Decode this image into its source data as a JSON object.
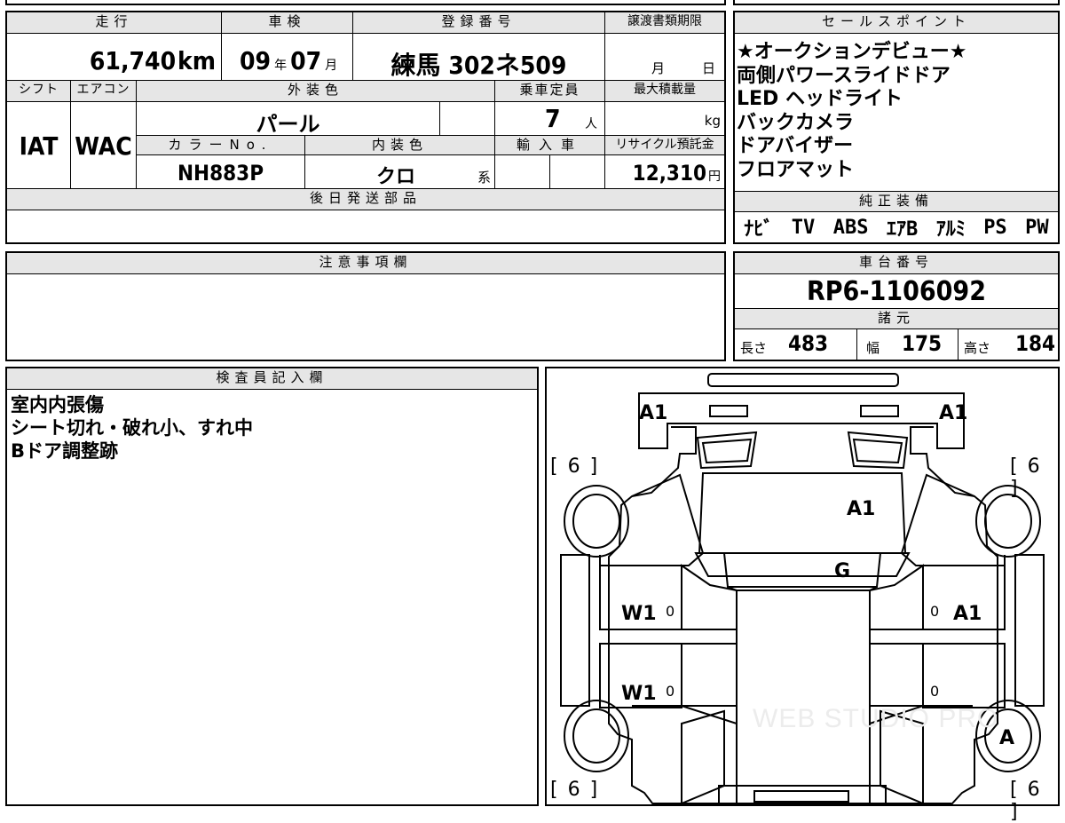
{
  "vehicle": {
    "mileage_header": "走行",
    "mileage_value": "61,740",
    "mileage_unit": "km",
    "inspection_header": "車検",
    "inspection_year": "09",
    "inspection_year_unit": "年",
    "inspection_month": "07",
    "inspection_month_unit": "月",
    "registration_header": "登録番号",
    "registration_value": "練馬 302ネ509",
    "transfer_header": "譲渡書類期限",
    "transfer_month_unit": "月",
    "transfer_day_unit": "日",
    "shift_header": "シフト",
    "shift_value": "IAT",
    "ac_header": "エアコン",
    "ac_value": "WAC",
    "exterior_header": "外装色",
    "exterior_value": "パール",
    "capacity_header": "乗車定員",
    "capacity_value": "7",
    "capacity_unit": "人",
    "maxload_header": "最大積載量",
    "maxload_unit": "kg",
    "colorno_header": "カラーNo.",
    "colorno_value": "NH883P",
    "interior_header": "内装色",
    "interior_value": "クロ",
    "interior_unit": "系",
    "import_header": "輸入車",
    "recycle_header": "リサイクル預託金",
    "recycle_value": "12,310",
    "recycle_unit": "円",
    "later_parts_header": "後日発送部品"
  },
  "sales_points": {
    "header": "セールスポイント",
    "lines": [
      "★オークションデビュー★",
      "両側パワースライドドア",
      "LED ヘッドライト",
      "バックカメラ",
      "ドアバイザー",
      "フロアマット"
    ]
  },
  "equipment": {
    "header": "純正装備",
    "items": [
      "ﾅﾋﾞ",
      "TV",
      "ABS",
      "ｴｱB",
      "ｱﾙﾐ",
      "PS",
      "PW"
    ]
  },
  "notes": {
    "header": "注意事項欄"
  },
  "chassis": {
    "header": "車台番号",
    "value": "RP6-1106092"
  },
  "specs": {
    "header": "諸元",
    "length_label": "長さ",
    "length_value": "483",
    "width_label": "幅",
    "width_value": "175",
    "height_label": "高さ",
    "height_value": "184"
  },
  "inspector": {
    "header": "検査員記入欄",
    "lines": [
      "室内内張傷",
      "シート切れ・破れ小、すれ中",
      "Bドア調整跡"
    ]
  },
  "diagram": {
    "tire_labels": [
      "[ 6 ]",
      "[ 6 ]",
      "[ 6 ]",
      "[ 6 ]"
    ],
    "marks": {
      "front_left": "A1",
      "front_right": "A1",
      "hood": "A1",
      "windshield": "G",
      "left_front_door": "W1",
      "left_rear_door": "W1",
      "right_front_door": "A1",
      "rear_right_wheel": "A",
      "zero_1": "0",
      "zero_2": "0",
      "zero_3": "0",
      "zero_4": "0"
    },
    "watermark": "WEB STUDIO PRO"
  }
}
